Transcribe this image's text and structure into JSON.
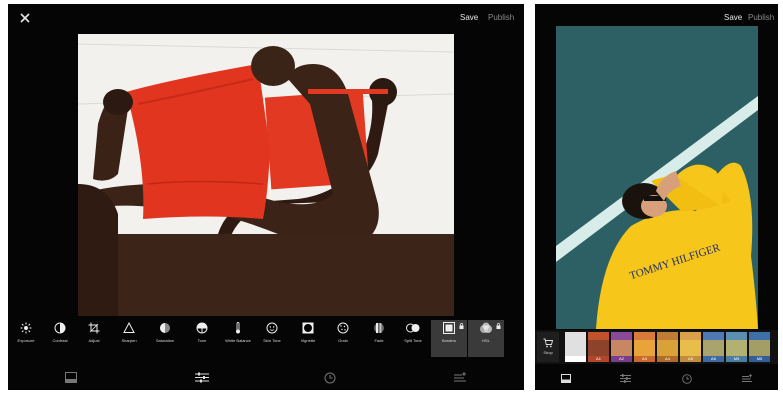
{
  "left_screen": {
    "save_label": "Save",
    "publish_label": "Publish",
    "tools": [
      {
        "label": "Exposure",
        "icon": "sun-icon"
      },
      {
        "label": "Contrast",
        "icon": "contrast-icon"
      },
      {
        "label": "Adjust",
        "icon": "crop-icon"
      },
      {
        "label": "Sharpen",
        "icon": "triangle-icon"
      },
      {
        "label": "Saturation",
        "icon": "saturation-icon"
      },
      {
        "label": "Tone",
        "icon": "tone-icon"
      },
      {
        "label": "White Balance",
        "icon": "thermometer-icon"
      },
      {
        "label": "Skin Tone",
        "icon": "face-icon"
      },
      {
        "label": "Vignette",
        "icon": "vignette-icon"
      },
      {
        "label": "Grain",
        "icon": "grain-icon"
      },
      {
        "label": "Fade",
        "icon": "fade-icon"
      },
      {
        "label": "Split Tone",
        "icon": "split-tone-icon"
      },
      {
        "label": "Borders",
        "icon": "borders-icon",
        "locked": true
      },
      {
        "label": "HSL",
        "icon": "hsl-icon",
        "locked": true
      }
    ],
    "bottom_nav": [
      "gallery-icon",
      "adjust-sliders-icon",
      "history-icon",
      "recipes-icon"
    ]
  },
  "right_screen": {
    "save_label": "Save",
    "publish_label": "Publish",
    "shop_label": "Shop",
    "presets": [
      {
        "label": "",
        "color": "#d9d9d9"
      },
      {
        "label": "A1",
        "color": "#c0522d"
      },
      {
        "label": "A2",
        "color": "#8a4a9a"
      },
      {
        "label": "A3",
        "color": "#d77a3a"
      },
      {
        "label": "A4",
        "color": "#c07b35"
      },
      {
        "label": "A5",
        "color": "#d8a14a"
      },
      {
        "label": "A6",
        "color": "#4d79b4"
      },
      {
        "label": "M3",
        "color": "#5a8fb0"
      },
      {
        "label": "M5",
        "color": "#3f6fa8"
      }
    ],
    "bottom_nav": [
      "gallery-icon",
      "adjust-sliders-icon",
      "history-icon",
      "recipes-icon"
    ]
  },
  "colors": {
    "accent_red": "#e2351f",
    "sweater_yellow": "#f5c518",
    "court_teal": "#2b5f63"
  }
}
